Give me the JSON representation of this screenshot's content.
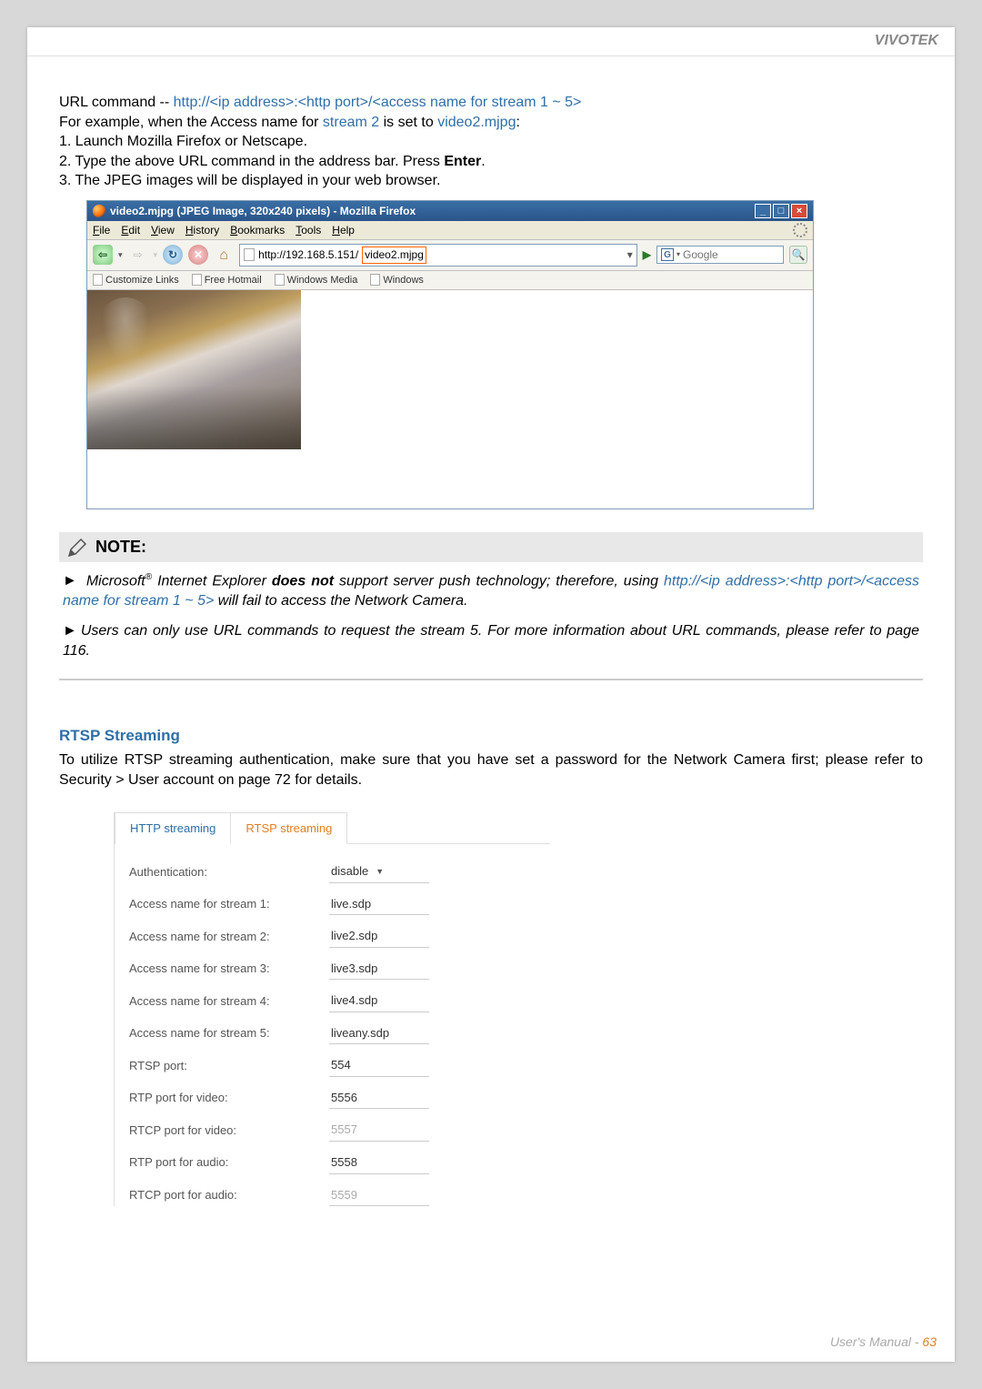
{
  "header": {
    "brand": "VIVOTEK"
  },
  "intro": {
    "url_cmd_label": "URL command -- ",
    "url_cmd_value": "http://<ip address>:<http port>/<access name for stream 1 ~ 5>",
    "example_prefix": "For example, when the Access name for ",
    "example_stream": "stream 2",
    "example_mid": " is set to ",
    "example_file": "video2.mjpg",
    "example_suffix": ":",
    "step1": "1. Launch Mozilla Firefox or Netscape.",
    "step2_pre": "2. Type the above URL command in the address bar. Press ",
    "step2_bold": "Enter",
    "step2_post": ".",
    "step3": "3. The JPEG images will be displayed in your web browser."
  },
  "browser": {
    "title": "video2.mjpg (JPEG Image, 320x240 pixels) - Mozilla Firefox",
    "menus": [
      "File",
      "Edit",
      "View",
      "History",
      "Bookmarks",
      "Tools",
      "Help"
    ],
    "address_pre": "http://192.168.5.151/",
    "address_sel": "video2.mjpg",
    "search_placeholder": "Google",
    "bookmarks": [
      "Customize Links",
      "Free Hotmail",
      "Windows Media",
      "Windows"
    ]
  },
  "note": {
    "heading": "NOTE:",
    "p1_a": "Microsoft",
    "p1_sup": "®",
    "p1_b": " Internet Explorer ",
    "p1_bold": "does not",
    "p1_c": " support server push technology; therefore, using ",
    "p1_url": "http://<ip address>:<http port>/<access name for stream 1 ~ 5>",
    "p1_d": " will fail to access the Network Camera.",
    "p2": "Users can only use URL commands to request the stream 5. For more information about URL commands, please refer to page 116."
  },
  "rtsp": {
    "heading": "RTSP Streaming",
    "body": "To utilize RTSP streaming authentication, make sure that you have set a password for the Network Camera first; please refer to Security > User account on page 72 for details."
  },
  "panel": {
    "tab_inactive": "HTTP streaming",
    "tab_active": "RTSP streaming",
    "rows": [
      {
        "label": "Authentication:",
        "value": "disable",
        "dropdown": true,
        "editable": true
      },
      {
        "label": "Access name for stream 1:",
        "value": "live.sdp",
        "editable": true
      },
      {
        "label": "Access name for stream 2:",
        "value": "live2.sdp",
        "editable": true
      },
      {
        "label": "Access name for stream 3:",
        "value": "live3.sdp",
        "editable": true
      },
      {
        "label": "Access name for stream 4:",
        "value": "live4.sdp",
        "editable": true
      },
      {
        "label": "Access name for stream 5:",
        "value": "liveany.sdp",
        "editable": true
      },
      {
        "label": "RTSP port:",
        "value": "554",
        "editable": true
      },
      {
        "label": "RTP port for video:",
        "value": "5556",
        "editable": true
      },
      {
        "label": "RTCP port for video:",
        "value": "5557",
        "editable": false
      },
      {
        "label": "RTP port for audio:",
        "value": "5558",
        "editable": true
      },
      {
        "label": "RTCP port for audio:",
        "value": "5559",
        "editable": false
      }
    ]
  },
  "footer": {
    "text": "User's Manual - ",
    "page": "63"
  }
}
